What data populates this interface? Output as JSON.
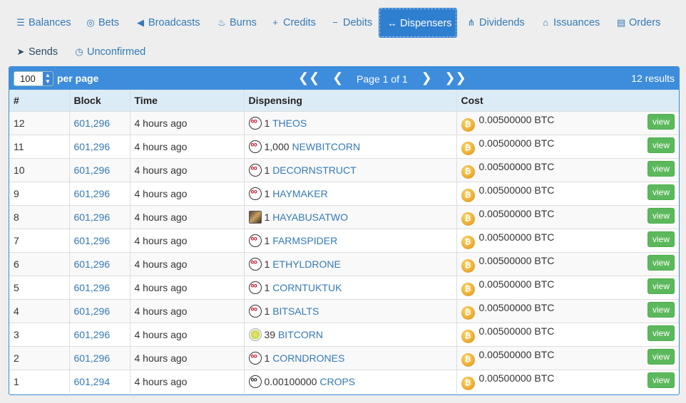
{
  "tabs": [
    {
      "label": "Balances",
      "icon": "list-icon"
    },
    {
      "label": "Bets",
      "icon": "target-icon"
    },
    {
      "label": "Broadcasts",
      "icon": "megaphone-icon"
    },
    {
      "label": "Burns",
      "icon": "fire-icon"
    },
    {
      "label": "Credits",
      "icon": "plus-icon"
    },
    {
      "label": "Debits",
      "icon": "minus-icon"
    },
    {
      "label": "Dispensers",
      "icon": "arrows-horizontal-icon"
    },
    {
      "label": "Dividends",
      "icon": "sitemap-icon"
    },
    {
      "label": "Issuances",
      "icon": "bank-icon"
    },
    {
      "label": "Orders",
      "icon": "book-icon"
    },
    {
      "label": "Sends",
      "icon": "paper-plane-icon"
    },
    {
      "label": "Unconfirmed",
      "icon": "clock-icon"
    }
  ],
  "active_tab": "Dispensers",
  "pagination": {
    "per_page_value": "100",
    "per_page_label": "per page",
    "first": "❮❮",
    "prev": "❮",
    "page_text": "Page 1 of 1",
    "next": "❯",
    "last": "❯❯",
    "results": "12 results"
  },
  "table": {
    "headers": [
      "#",
      "Block",
      "Time",
      "Dispensing",
      "Cost"
    ],
    "view_label": "view",
    "rows": [
      {
        "num": "12",
        "block": "601,296",
        "time": "4 hours ago",
        "qty": "1",
        "asset": "THEOS",
        "icon": "infinity-red-icon",
        "cost": "0.00500000 BTC"
      },
      {
        "num": "11",
        "block": "601,296",
        "time": "4 hours ago",
        "qty": "1,000",
        "asset": "NEWBITCORN",
        "icon": "infinity-red-icon",
        "cost": "0.00500000 BTC"
      },
      {
        "num": "10",
        "block": "601,296",
        "time": "4 hours ago",
        "qty": "1",
        "asset": "DECORNSTRUCT",
        "icon": "infinity-red-icon",
        "cost": "0.00500000 BTC"
      },
      {
        "num": "9",
        "block": "601,296",
        "time": "4 hours ago",
        "qty": "1",
        "asset": "HAYMAKER",
        "icon": "infinity-red-icon",
        "cost": "0.00500000 BTC"
      },
      {
        "num": "8",
        "block": "601,296",
        "time": "4 hours ago",
        "qty": "1",
        "asset": "HAYABUSATWO",
        "icon": "image-thumbnail-icon",
        "cost": "0.00500000 BTC"
      },
      {
        "num": "7",
        "block": "601,296",
        "time": "4 hours ago",
        "qty": "1",
        "asset": "FARMSPIDER",
        "icon": "infinity-red-icon",
        "cost": "0.00500000 BTC"
      },
      {
        "num": "6",
        "block": "601,296",
        "time": "4 hours ago",
        "qty": "1",
        "asset": "ETHYLDRONE",
        "icon": "infinity-red-icon",
        "cost": "0.00500000 BTC"
      },
      {
        "num": "5",
        "block": "601,296",
        "time": "4 hours ago",
        "qty": "1",
        "asset": "CORNTUKTUK",
        "icon": "infinity-red-icon",
        "cost": "0.00500000 BTC"
      },
      {
        "num": "4",
        "block": "601,296",
        "time": "4 hours ago",
        "qty": "1",
        "asset": "BITSALTS",
        "icon": "infinity-red-icon",
        "cost": "0.00500000 BTC"
      },
      {
        "num": "3",
        "block": "601,296",
        "time": "4 hours ago",
        "qty": "39",
        "asset": "BITCORN",
        "icon": "corn-icon",
        "cost": "0.00500000 BTC"
      },
      {
        "num": "2",
        "block": "601,296",
        "time": "4 hours ago",
        "qty": "1",
        "asset": "CORNDRONES",
        "icon": "infinity-red-icon",
        "cost": "0.00500000 BTC"
      },
      {
        "num": "1",
        "block": "601,294",
        "time": "4 hours ago",
        "qty": "0.00100000",
        "asset": "CROPS",
        "icon": "infinity-dark-icon",
        "cost": "0.00500000 BTC"
      }
    ]
  },
  "colors": {
    "accent": "#3e8ddc",
    "link": "#337ab7",
    "header_row": "#dcecf7",
    "view_button": "#5cb85c",
    "btc_coin": "#e8a52b"
  }
}
